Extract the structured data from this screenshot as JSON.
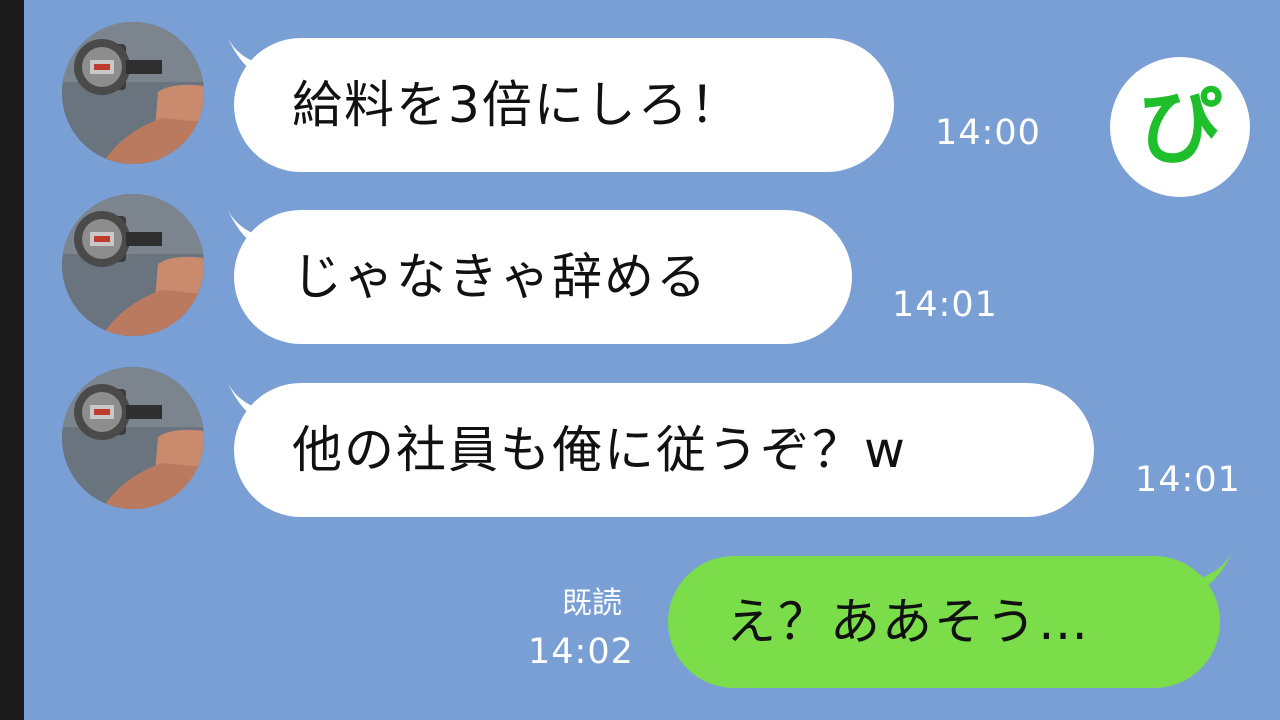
{
  "brand": {
    "logo_text": "ぴ",
    "logo_color": "#1fbf2c"
  },
  "colors": {
    "background": "#7a9fd4",
    "incoming_bubble": "#ffffff",
    "outgoing_bubble": "#7cdd4a"
  },
  "messages": [
    {
      "direction": "incoming",
      "text": "給料を3倍にしろ！",
      "time": "14:00"
    },
    {
      "direction": "incoming",
      "text": "じゃなきゃ辞める",
      "time": "14:01"
    },
    {
      "direction": "incoming",
      "text": "他の社員も俺に従うぞ？w",
      "time": "14:01"
    },
    {
      "direction": "outgoing",
      "text": "え？ああそう…",
      "time": "14:02",
      "read_label": "既読"
    }
  ]
}
